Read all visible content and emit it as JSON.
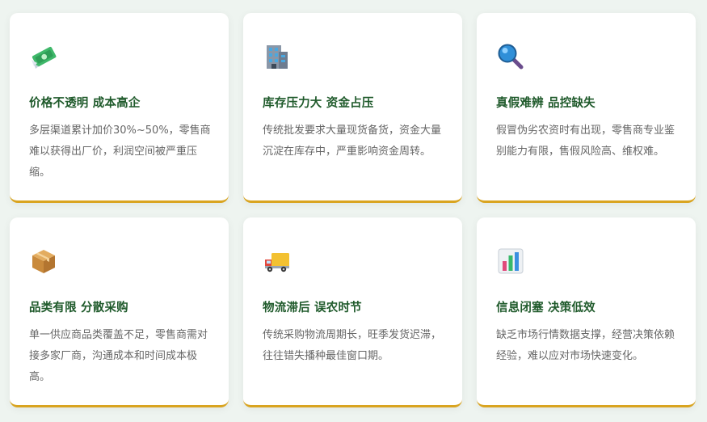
{
  "cards": [
    {
      "icon": "money-with-wings-icon",
      "title": "价格不透明 成本高企",
      "desc": "多层渠道累计加价30%~50%，零售商难以获得出厂价，利润空间被严重压缩。"
    },
    {
      "icon": "office-building-icon",
      "title": "库存压力大 资金占压",
      "desc": "传统批发要求大量现货备货，资金大量沉淀在库存中，严重影响资金周转。"
    },
    {
      "icon": "magnifying-glass-icon",
      "title": "真假难辨 品控缺失",
      "desc": "假冒伪劣农资时有出现，零售商专业鉴别能力有限，售假风险高、维权难。"
    },
    {
      "icon": "package-box-icon",
      "title": "品类有限 分散采购",
      "desc": "单一供应商品类覆盖不足，零售商需对接多家厂商，沟通成本和时间成本极高。"
    },
    {
      "icon": "delivery-truck-icon",
      "title": "物流滞后 误农时节",
      "desc": "传统采购物流周期长，旺季发货迟滞，往往错失播种最佳窗口期。"
    },
    {
      "icon": "bar-chart-icon",
      "title": "信息闭塞 决策低效",
      "desc": "缺乏市场行情数据支撑，经营决策依赖经验，难以应对市场快速变化。"
    }
  ]
}
